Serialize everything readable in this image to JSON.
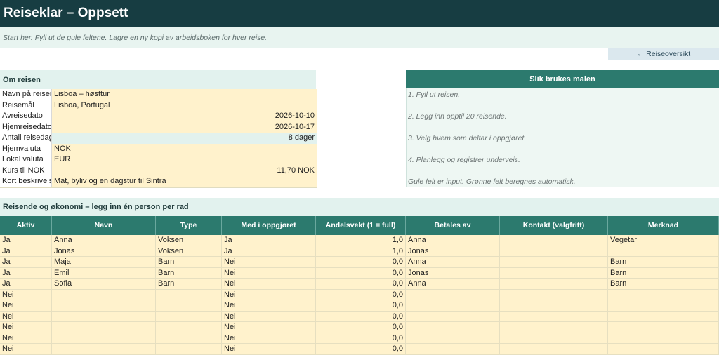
{
  "title": "Reiseklar – Oppsett",
  "intro": "Start her. Fyll ut de gule feltene. Lagre en ny kopi av arbeidsboken for hver reise.",
  "nav_button": "← Reiseoversikt",
  "om_reisen": {
    "heading": "Om reisen",
    "rows": [
      {
        "label": "Navn på reisen",
        "value": "Lisboa – høsttur"
      },
      {
        "label": "Reisemål",
        "value": "Lisboa, Portugal"
      },
      {
        "label": "Avreisedato",
        "value": "2026-10-10"
      },
      {
        "label": "Hjemreisedato",
        "value": "2026-10-17"
      },
      {
        "label": "Antall reisedager",
        "value": "8 dager"
      },
      {
        "label": "Hjemvaluta",
        "value": "NOK"
      },
      {
        "label": "Lokal valuta",
        "value": "EUR"
      },
      {
        "label": "Kurs til NOK",
        "value": "11,70 NOK"
      },
      {
        "label": "Kort beskrivelse",
        "value": "Mat, byliv og en dagstur til Sintra"
      }
    ]
  },
  "how_to": {
    "heading": "Slik brukes malen",
    "lines": [
      "1. Fyll ut reisen.",
      "2. Legg inn opptil 20 reisende.",
      "3. Velg hvem som deltar i oppgjøret.",
      "4. Planlegg og registrer underveis.",
      "Gule felt er input. Grønne felt beregnes automatisk."
    ]
  },
  "travelers": {
    "heading": "Reisende og økonomi – legg inn én person per rad",
    "columns": [
      "Aktiv",
      "Navn",
      "Type",
      "Med i oppgjøret",
      "Andelsvekt (1 = full)",
      "Betales av",
      "Kontakt (valgfritt)",
      "Merknad"
    ],
    "rows": [
      [
        "Ja",
        "Anna",
        "Voksen",
        "Ja",
        "1,0",
        "Anna",
        "",
        "Vegetar"
      ],
      [
        "Ja",
        "Jonas",
        "Voksen",
        "Ja",
        "1,0",
        "Jonas",
        "",
        ""
      ],
      [
        "Ja",
        "Maja",
        "Barn",
        "Nei",
        "0,0",
        "Anna",
        "",
        "Barn"
      ],
      [
        "Ja",
        "Emil",
        "Barn",
        "Nei",
        "0,0",
        "Jonas",
        "",
        "Barn"
      ],
      [
        "Ja",
        "Sofia",
        "Barn",
        "Nei",
        "0,0",
        "Anna",
        "",
        "Barn"
      ],
      [
        "Nei",
        "",
        "",
        "Nei",
        "0,0",
        "",
        "",
        ""
      ],
      [
        "Nei",
        "",
        "",
        "Nei",
        "0,0",
        "",
        "",
        ""
      ],
      [
        "Nei",
        "",
        "",
        "Nei",
        "0,0",
        "",
        "",
        ""
      ],
      [
        "Nei",
        "",
        "",
        "Nei",
        "0,0",
        "",
        "",
        ""
      ],
      [
        "Nei",
        "",
        "",
        "Nei",
        "0,0",
        "",
        "",
        ""
      ],
      [
        "Nei",
        "",
        "",
        "Nei",
        "0,0",
        "",
        "",
        ""
      ]
    ]
  }
}
